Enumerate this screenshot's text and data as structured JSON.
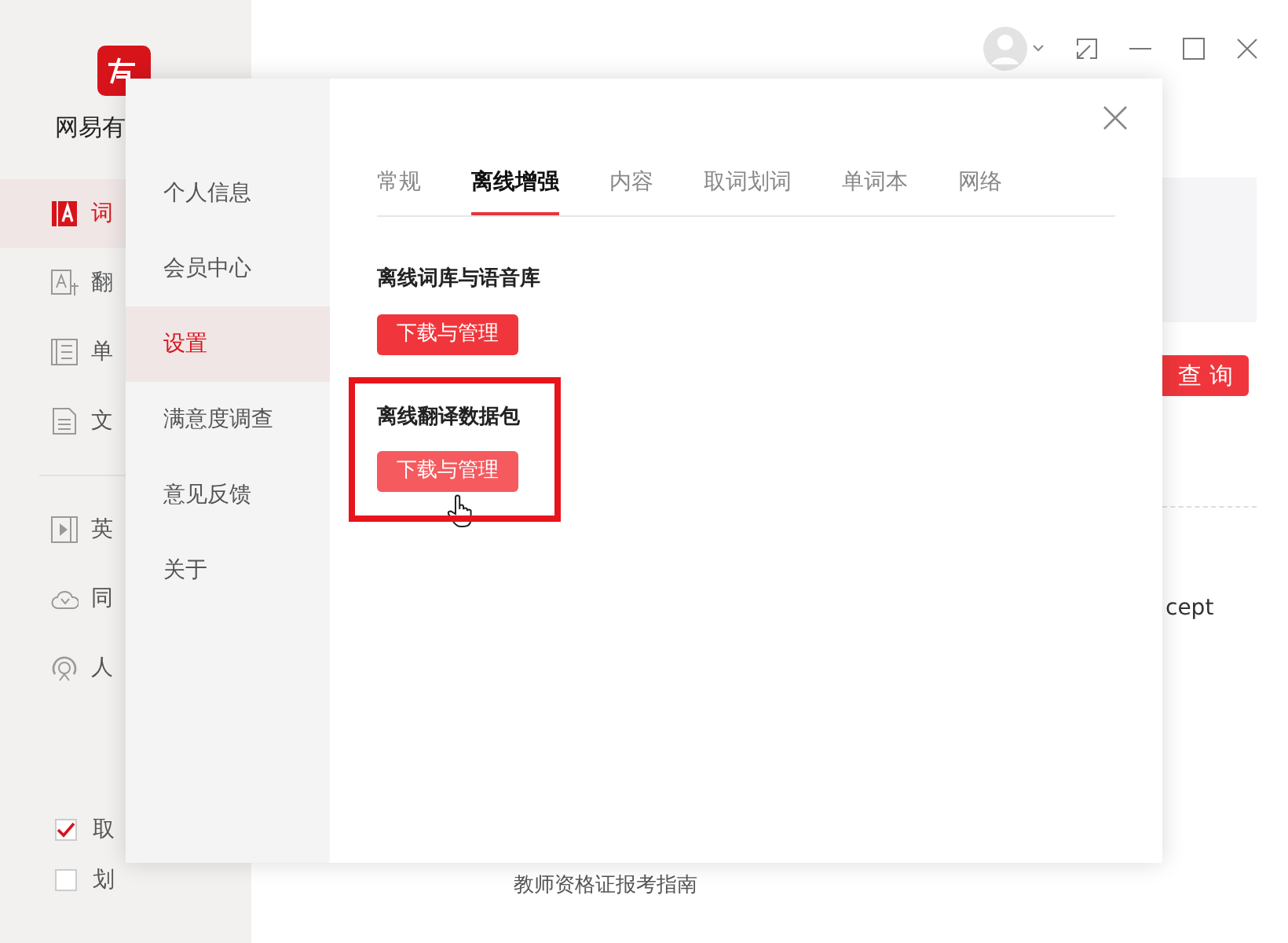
{
  "app": {
    "name": "网易有"
  },
  "sidebar": {
    "items": [
      {
        "label": "词",
        "kind": "dict",
        "selected": true
      },
      {
        "label": "翻",
        "kind": "translate",
        "selected": false
      },
      {
        "label": "单",
        "kind": "wordbook",
        "selected": false
      },
      {
        "label": "文",
        "kind": "document",
        "selected": false
      }
    ],
    "items_2": [
      {
        "label": "英",
        "kind": "video",
        "selected": false
      },
      {
        "label": "同",
        "kind": "cloud",
        "selected": false
      },
      {
        "label": "人",
        "kind": "person",
        "selected": false
      }
    ],
    "options": [
      {
        "label": "取",
        "checked": true
      },
      {
        "label": "划",
        "checked": false
      }
    ]
  },
  "background": {
    "search_button": "查 询",
    "text_fragment": "cept",
    "article_title": "教师资格证报考指南"
  },
  "settings_dialog": {
    "menu": [
      {
        "label": "个人信息",
        "selected": false
      },
      {
        "label": "会员中心",
        "selected": false
      },
      {
        "label": "设置",
        "selected": true
      },
      {
        "label": "满意度调查",
        "selected": false
      },
      {
        "label": "意见反馈",
        "selected": false
      },
      {
        "label": "关于",
        "selected": false
      }
    ],
    "tabs": [
      {
        "label": "常规",
        "selected": false
      },
      {
        "label": "离线增强",
        "selected": true
      },
      {
        "label": "内容",
        "selected": false
      },
      {
        "label": "取词划词",
        "selected": false
      },
      {
        "label": "单词本",
        "selected": false
      },
      {
        "label": "网络",
        "selected": false
      }
    ],
    "sections": [
      {
        "title": "离线词库与语音库",
        "button": "下载与管理",
        "hovered": false,
        "highlighted": false
      },
      {
        "title": "离线翻译数据包",
        "button": "下载与管理",
        "hovered": true,
        "highlighted": true
      }
    ]
  }
}
